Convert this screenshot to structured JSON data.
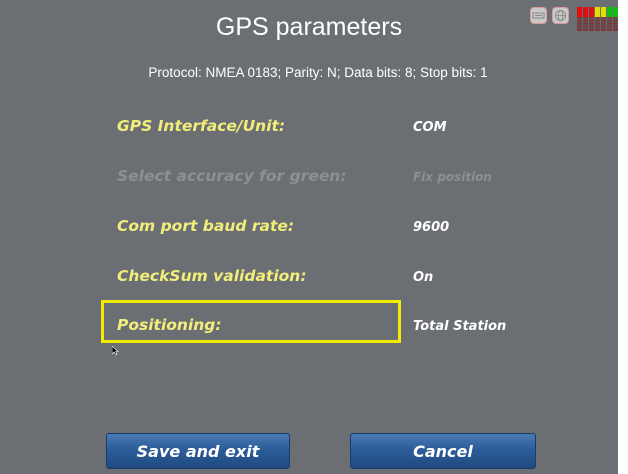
{
  "header": {
    "title": "GPS parameters",
    "subtitle": "Protocol: NMEA 0183; Parity: N; Data bits: 8; Stop bits: 1"
  },
  "rows": [
    {
      "label": "GPS Interface/Unit:",
      "value": "COM",
      "enabled": true
    },
    {
      "label": "Select accuracy for green:",
      "value": "Fix position",
      "enabled": false
    },
    {
      "label": "Com port baud rate:",
      "value": "9600",
      "enabled": true
    },
    {
      "label": "CheckSum validation:",
      "value": "On",
      "enabled": true
    },
    {
      "label": "Positioning:",
      "value": "Total Station",
      "enabled": true,
      "selected": true
    }
  ],
  "buttons": {
    "save": "Save and exit",
    "cancel": "Cancel"
  },
  "status": {
    "icons": [
      "keyboard-icon",
      "globe-icon"
    ],
    "signal_colors": [
      "#e01010",
      "#e01010",
      "#e01010",
      "#e0e000",
      "#e0e000",
      "#10c010",
      "#10c010"
    ]
  },
  "colors": {
    "background": "#6b6f73",
    "label": "#f2ee7a",
    "disabled": "#8d9093",
    "highlight": "#f2ec00",
    "button": "#2d5d99"
  }
}
